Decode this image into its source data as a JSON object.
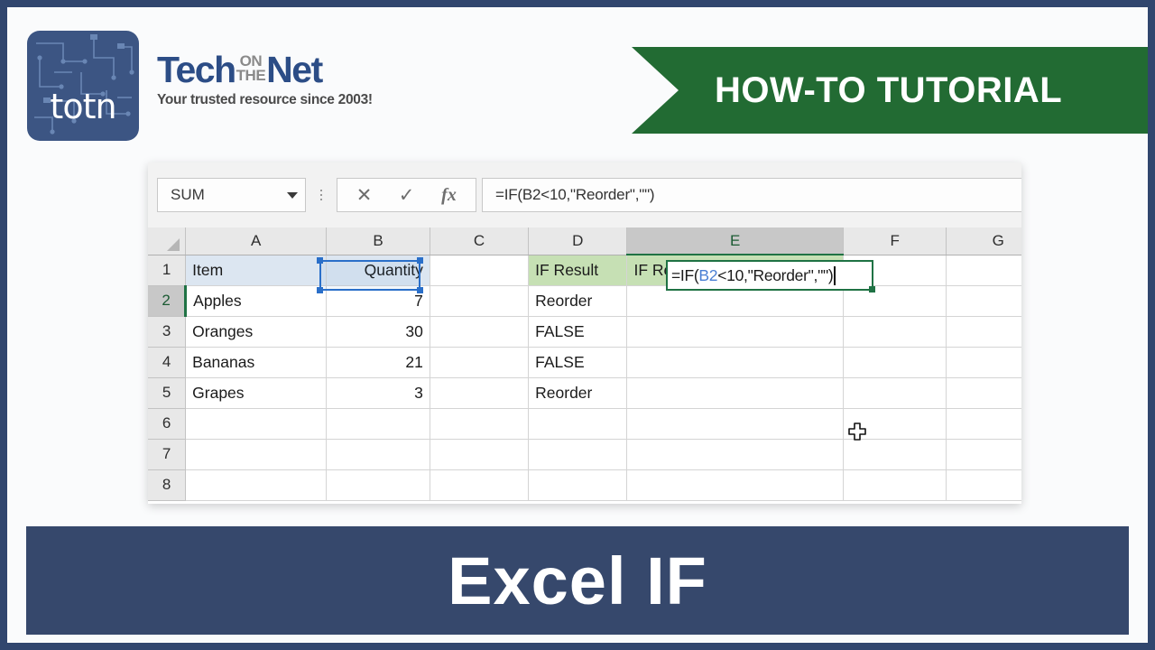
{
  "brand": {
    "mark_text": "totn",
    "name_part1": "Tech",
    "name_on": "ON",
    "name_the": "THE",
    "name_part2": "Net",
    "tagline": "Your trusted resource since 2003!"
  },
  "ribbon": {
    "label": "HOW-TO TUTORIAL",
    "color": "#226b33"
  },
  "excel": {
    "name_box_value": "SUM",
    "cancel_icon": "✕",
    "confirm_icon": "✓",
    "fx_icon": "fx",
    "formula_bar_value": "=IF(B2<10,\"Reorder\",\"\")",
    "column_headers": [
      "A",
      "B",
      "C",
      "D",
      "E",
      "F",
      "G"
    ],
    "active_column": "E",
    "active_row": "2",
    "row_numbers": [
      "1",
      "2",
      "3",
      "4",
      "5",
      "6",
      "7",
      "8"
    ],
    "rows": [
      {
        "n": "1",
        "A": "Item",
        "B": "Quantity",
        "C": "",
        "D": "IF Result",
        "E": "IF Result (with ELSE)",
        "F": "",
        "G": ""
      },
      {
        "n": "2",
        "A": "Apples",
        "B": "7",
        "C": "",
        "D": "Reorder",
        "E": "",
        "F": "",
        "G": ""
      },
      {
        "n": "3",
        "A": "Oranges",
        "B": "30",
        "C": "",
        "D": "FALSE",
        "E": "",
        "F": "",
        "G": ""
      },
      {
        "n": "4",
        "A": "Bananas",
        "B": "21",
        "C": "",
        "D": "FALSE",
        "E": "",
        "F": "",
        "G": ""
      },
      {
        "n": "5",
        "A": "Grapes",
        "B": "3",
        "C": "",
        "D": "Reorder",
        "E": "",
        "F": "",
        "G": ""
      },
      {
        "n": "6",
        "A": "",
        "B": "",
        "C": "",
        "D": "",
        "E": "",
        "F": "",
        "G": ""
      },
      {
        "n": "7",
        "A": "",
        "B": "",
        "C": "",
        "D": "",
        "E": "",
        "F": "",
        "G": ""
      },
      {
        "n": "8",
        "A": "",
        "B": "",
        "C": "",
        "D": "",
        "E": "",
        "F": "",
        "G": ""
      }
    ],
    "edit_cell": {
      "address": "E2",
      "prefix": "=IF(",
      "reference": "B2",
      "suffix": "<10,\"Reorder\",\"\")"
    },
    "selected_reference_cell": "B2",
    "colors": {
      "header_fill_green": "#c6e0b4",
      "header_fill_blue": "#dce6f1",
      "active_green": "#1f7244",
      "reference_blue": "#2a6fc9"
    }
  },
  "banner": {
    "title": "Excel IF",
    "background": "#36486c"
  }
}
